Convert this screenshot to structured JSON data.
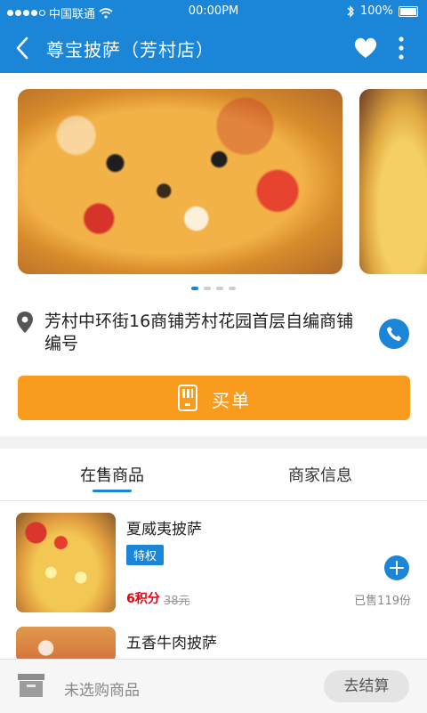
{
  "status_bar": {
    "carrier": "中国联通",
    "time": "00:00PM",
    "battery": "100%"
  },
  "navbar": {
    "title": "尊宝披萨（芳村店）"
  },
  "carousel": {
    "slides": 4,
    "active_index": 0
  },
  "shop": {
    "address": "芳村中环街16商铺芳村花园首层自编商铺编号"
  },
  "buy_button": {
    "label": "买单"
  },
  "tabs": [
    {
      "label": "在售商品",
      "active": true
    },
    {
      "label": "商家信息",
      "active": false
    }
  ],
  "products": [
    {
      "name": "夏威夷披萨",
      "badge": "特权",
      "price": "6积分",
      "original_price": "38元",
      "sold": "已售119份"
    },
    {
      "name": "五香牛肉披萨"
    }
  ],
  "cart": {
    "empty_text": "未选购商品",
    "checkout_label": "去结算"
  },
  "colors": {
    "primary": "#1b86d7",
    "accent": "#f99b1d",
    "price": "#e60012"
  }
}
